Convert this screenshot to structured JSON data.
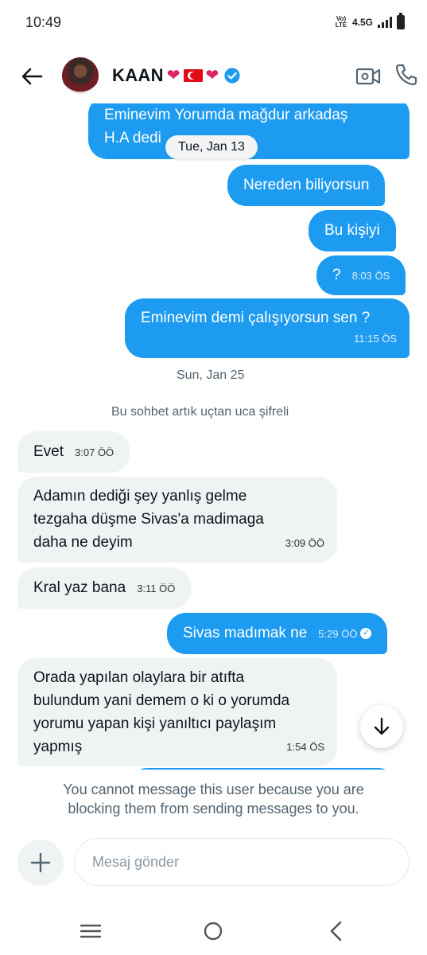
{
  "status_bar": {
    "time": "10:49",
    "volte": "Vo) LTE",
    "network": "4.5G"
  },
  "header": {
    "name": "KAAN",
    "emoji": [
      "❤",
      "flag-turkey",
      "❤"
    ],
    "verified_icon": "verified-badge-icon",
    "accent_color": "#1d9bf0"
  },
  "messages": [
    {
      "dir": "out",
      "text_line1": "Eminevim Yorumda mağdur arkadaş",
      "text_line2": "H.A dedi"
    },
    {
      "date_pill": "Tue, Jan 13"
    },
    {
      "dir": "out",
      "text": "Nereden biliyorsun"
    },
    {
      "dir": "out",
      "text": "Bu kişiyi"
    },
    {
      "dir": "out",
      "text": "?",
      "time": "8:03 ÖS"
    },
    {
      "dir": "out",
      "text": "Eminevim demi çalışıyorsun sen ?",
      "time": "11:15 ÖS"
    },
    {
      "date_sep": "Sun, Jan 25"
    },
    {
      "system": "Bu sohbet artık uçtan uca şifreli"
    },
    {
      "dir": "in",
      "text": "Evet",
      "time": "3:07 ÖÖ"
    },
    {
      "dir": "in",
      "lines": [
        "Adamın dediği şey yanlış gelme",
        "tezgaha düşme Sivas'a madimaga",
        "daha ne deyim"
      ],
      "time": "3:09 ÖÖ"
    },
    {
      "dir": "in",
      "text": "Kral yaz bana",
      "time": "3:11 ÖÖ"
    },
    {
      "dir": "out",
      "text": "Sivas madımak ne",
      "time": "5:29 ÖÖ"
    },
    {
      "dir": "in",
      "lines": [
        "Orada yapılan olaylara bir atıfta",
        "bulundum yani demem o ki o yorumda",
        "yorumu yapan kişi yanıltıcı paylaşım",
        "yapmış"
      ],
      "time": "1:54 ÖS"
    }
  ],
  "footer": {
    "blocked_line1": "You cannot message this user because you are",
    "blocked_line2": "blocking them from sending messages to you.",
    "composer_placeholder": "Mesaj gönder"
  },
  "colors": {
    "outgoing_bubble": "#1d9bf0",
    "incoming_bubble": "#eff3f4",
    "muted_text": "#536471"
  }
}
